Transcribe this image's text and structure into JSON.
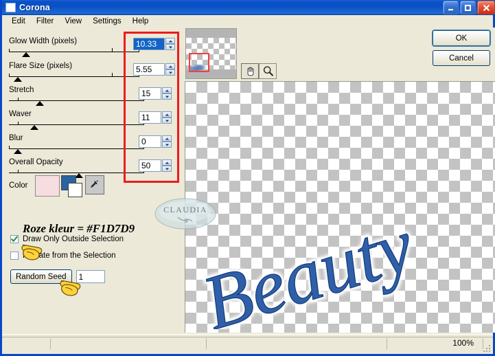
{
  "window": {
    "title": "Corona",
    "icon": "app-window-icon",
    "minimize_label": "Minimize",
    "maximize_label": "Maximize",
    "close_label": "Close"
  },
  "menu": {
    "items": [
      {
        "label": "Edit"
      },
      {
        "label": "Filter"
      },
      {
        "label": "View"
      },
      {
        "label": "Settings"
      },
      {
        "label": "Help"
      }
    ]
  },
  "parameters": [
    {
      "label": "Glow Width (pixels)",
      "value": "10.33",
      "selected": true,
      "thumb_pct": 3,
      "marker_pct": 74
    },
    {
      "label": "Flare Size (pixels)",
      "value": "5.55",
      "selected": false,
      "thumb_pct": 1,
      "marker_pct": 74
    },
    {
      "label": "Stretch",
      "value": "15",
      "selected": false,
      "thumb_pct": 30,
      "marker_pct": -1
    },
    {
      "label": "Waver",
      "value": "11",
      "selected": false,
      "thumb_pct": 22,
      "marker_pct": -1
    },
    {
      "label": "Blur",
      "value": "0",
      "selected": false,
      "thumb_pct": 1,
      "marker_pct": -1
    },
    {
      "label": "Overall Opacity",
      "value": "50",
      "selected": false,
      "thumb_pct": 52,
      "marker_pct": -1
    }
  ],
  "color_row": {
    "label": "Color",
    "pink_swatch": "#F5DDE0",
    "foreground_swatch": "#2A63A2",
    "background_swatch": "#FFFFFF",
    "eyedropper_label": "eyedropper"
  },
  "note": {
    "text": "Roze kleur = #F1D7D9",
    "hex": "#F1D7D9"
  },
  "options": [
    {
      "label": "Draw Only Outside Selection",
      "checked": true
    },
    {
      "label": "Radiate from the Selection",
      "checked": false
    }
  ],
  "random_seed": {
    "button_label": "Random Seed",
    "value": "1"
  },
  "preview": {
    "thumbnail_label": "navigator-thumbnail",
    "selection_label": "viewport-selection",
    "tools": [
      {
        "name": "pan-hand-tool",
        "active": true
      },
      {
        "name": "zoom-magnifier-tool",
        "active": false
      }
    ]
  },
  "dialog_buttons": {
    "ok": "OK",
    "cancel": "Cancel"
  },
  "canvas": {
    "artwork_text": "Beauty",
    "artwork_color": "#2F5FA8",
    "watermark_text": "CLAUDIA"
  },
  "statusbar": {
    "left_text": "",
    "zoom": "100%"
  },
  "annotations": {
    "red_box_label": "parameter-values-highlight",
    "hand_pointer_1": "pointer-draw-only-outside-selection",
    "hand_pointer_2": "pointer-random-seed-value"
  }
}
